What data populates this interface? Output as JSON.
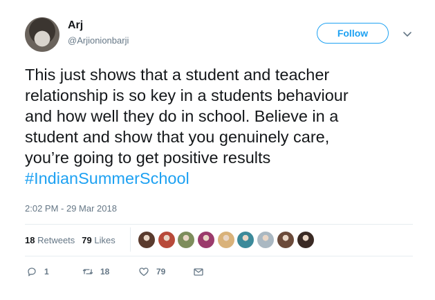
{
  "user": {
    "name": "Arj",
    "handle": "@Arjionionbarji"
  },
  "follow_label": "Follow",
  "tweet": {
    "text": "This just shows that a student and teacher\nrelationship is so key in a students behaviour\nand how well they do in school. Believe in a\nstudent and show that you genuinely care,\nyou’re going to get positive results\n",
    "hashtag": "#IndianSummerSchool",
    "timestamp": "2:02 PM - 29 Mar 2018"
  },
  "stats": {
    "retweets_count": "18",
    "retweets_label": "Retweets",
    "likes_count": "79",
    "likes_label": "Likes"
  },
  "likers": [
    {
      "color": "#5a3b2e"
    },
    {
      "color": "#b84a3a"
    },
    {
      "color": "#7d8d5c"
    },
    {
      "color": "#9b3b6c"
    },
    {
      "color": "#d9b27a"
    },
    {
      "color": "#3c8a9a"
    },
    {
      "color": "#aab8c2"
    },
    {
      "color": "#6b4a3a"
    },
    {
      "color": "#3a2a24"
    }
  ],
  "actions": {
    "reply_count": "1",
    "retweet_count": "18",
    "like_count": "79"
  },
  "colors": {
    "accent": "#1da1f2",
    "muted": "#657786",
    "text": "#14171a",
    "divider": "#e6ecf0"
  }
}
